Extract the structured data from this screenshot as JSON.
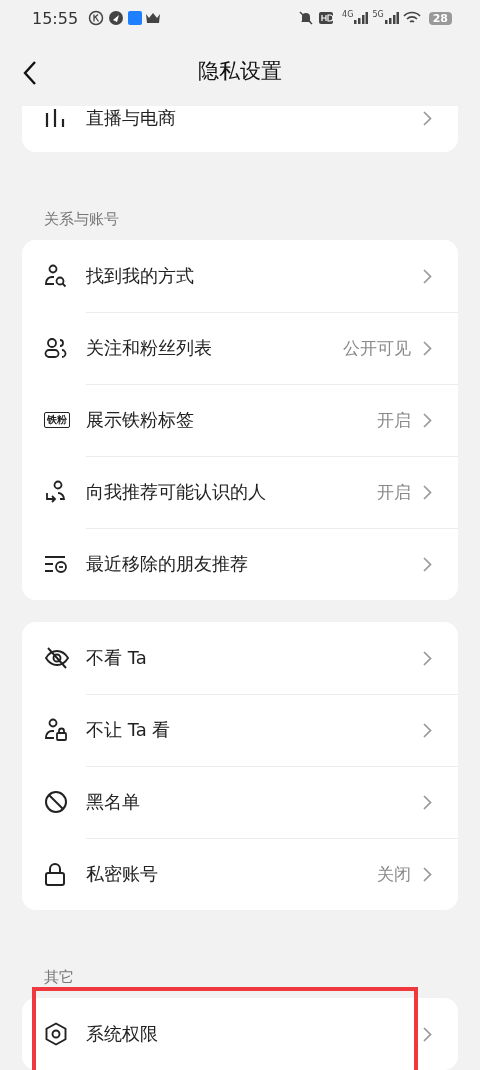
{
  "status_bar": {
    "time": "15:55",
    "network_1": "4G",
    "network_2": "5G",
    "battery": "28"
  },
  "header": {
    "title": "隐私设置"
  },
  "sections": [
    {
      "items": [
        {
          "kind": "bars",
          "label": "直播与电商",
          "highlighted": false
        }
      ]
    },
    {
      "title": "关系与账号",
      "items": [
        {
          "kind": "person-search",
          "label": "找到我的方式",
          "highlighted": false
        },
        {
          "kind": "people",
          "label": "关注和粉丝列表",
          "value": "公开可见",
          "highlighted": false
        },
        {
          "kind": "badge",
          "badge_text": "铁粉",
          "label": "展示铁粉标签",
          "value": "开启",
          "highlighted": false
        },
        {
          "kind": "person-suggest",
          "label": "向我推荐可能认识的人",
          "value": "开启",
          "highlighted": false
        },
        {
          "kind": "list-removed",
          "label": "最近移除的朋友推荐",
          "highlighted": false
        }
      ]
    },
    {
      "items": [
        {
          "kind": "eye-off",
          "label": "不看 Ta",
          "highlighted": false
        },
        {
          "kind": "person-lock",
          "label": "不让 Ta 看",
          "highlighted": false
        },
        {
          "kind": "block",
          "label": "黑名单",
          "highlighted": false
        },
        {
          "kind": "lock",
          "label": "私密账号",
          "value": "关闭",
          "highlighted": false
        }
      ]
    },
    {
      "title": "其它",
      "items": [
        {
          "kind": "hexagon",
          "label": "系统权限",
          "highlighted": true
        }
      ]
    }
  ]
}
